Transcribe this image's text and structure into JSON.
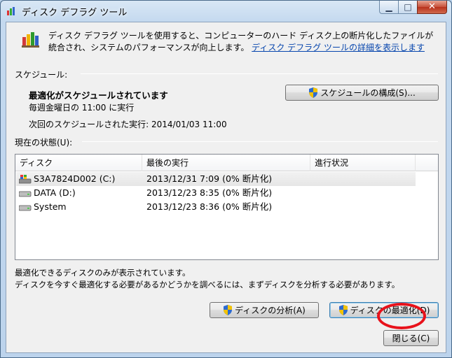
{
  "window": {
    "title": "ディスク デフラグ ツール"
  },
  "intro": {
    "text": "ディスク デフラグ ツールを使用すると、コンピューターのハード ディスク上の断片化したファイルが統合され、システムのパフォーマンスが向上します。",
    "link": "ディスク デフラグ ツールの詳細を表示します"
  },
  "schedule": {
    "label": "スケジュール:",
    "status": "最適化がスケジュールされています",
    "frequency": "毎週金曜日の 11:00 に実行",
    "next_run": "次回のスケジュールされた実行: 2014/01/03 11:00",
    "configure_button": "スケジュールの構成(S)..."
  },
  "current_state": {
    "label": "現在の状態(U):",
    "columns": [
      "ディスク",
      "最後の実行",
      "進行状況"
    ],
    "rows": [
      {
        "disk": "S3A7824D002 (C:)",
        "last_run": "2013/12/31 7:09 (0% 断片化)",
        "progress": "",
        "icon": "system-drive-icon"
      },
      {
        "disk": "DATA (D:)",
        "last_run": "2013/12/23 8:35 (0% 断片化)",
        "progress": "",
        "icon": "hard-drive-icon"
      },
      {
        "disk": "System",
        "last_run": "2013/12/23 8:36 (0% 断片化)",
        "progress": "",
        "icon": "hard-drive-icon"
      }
    ]
  },
  "notes": {
    "line1": "最適化できるディスクのみが表示されています。",
    "line2": "ディスクを今すぐ最適化する必要があるかどうかを調べるには、まずディスクを分析する必要があります。"
  },
  "actions": {
    "analyze_button": "ディスクの分析(A)",
    "defrag_button": "ディスクの最適化(D)",
    "close_button": "閉じる(C)"
  },
  "colors": {
    "link": "#0645ad",
    "highlight_circle": "#e8121b"
  }
}
